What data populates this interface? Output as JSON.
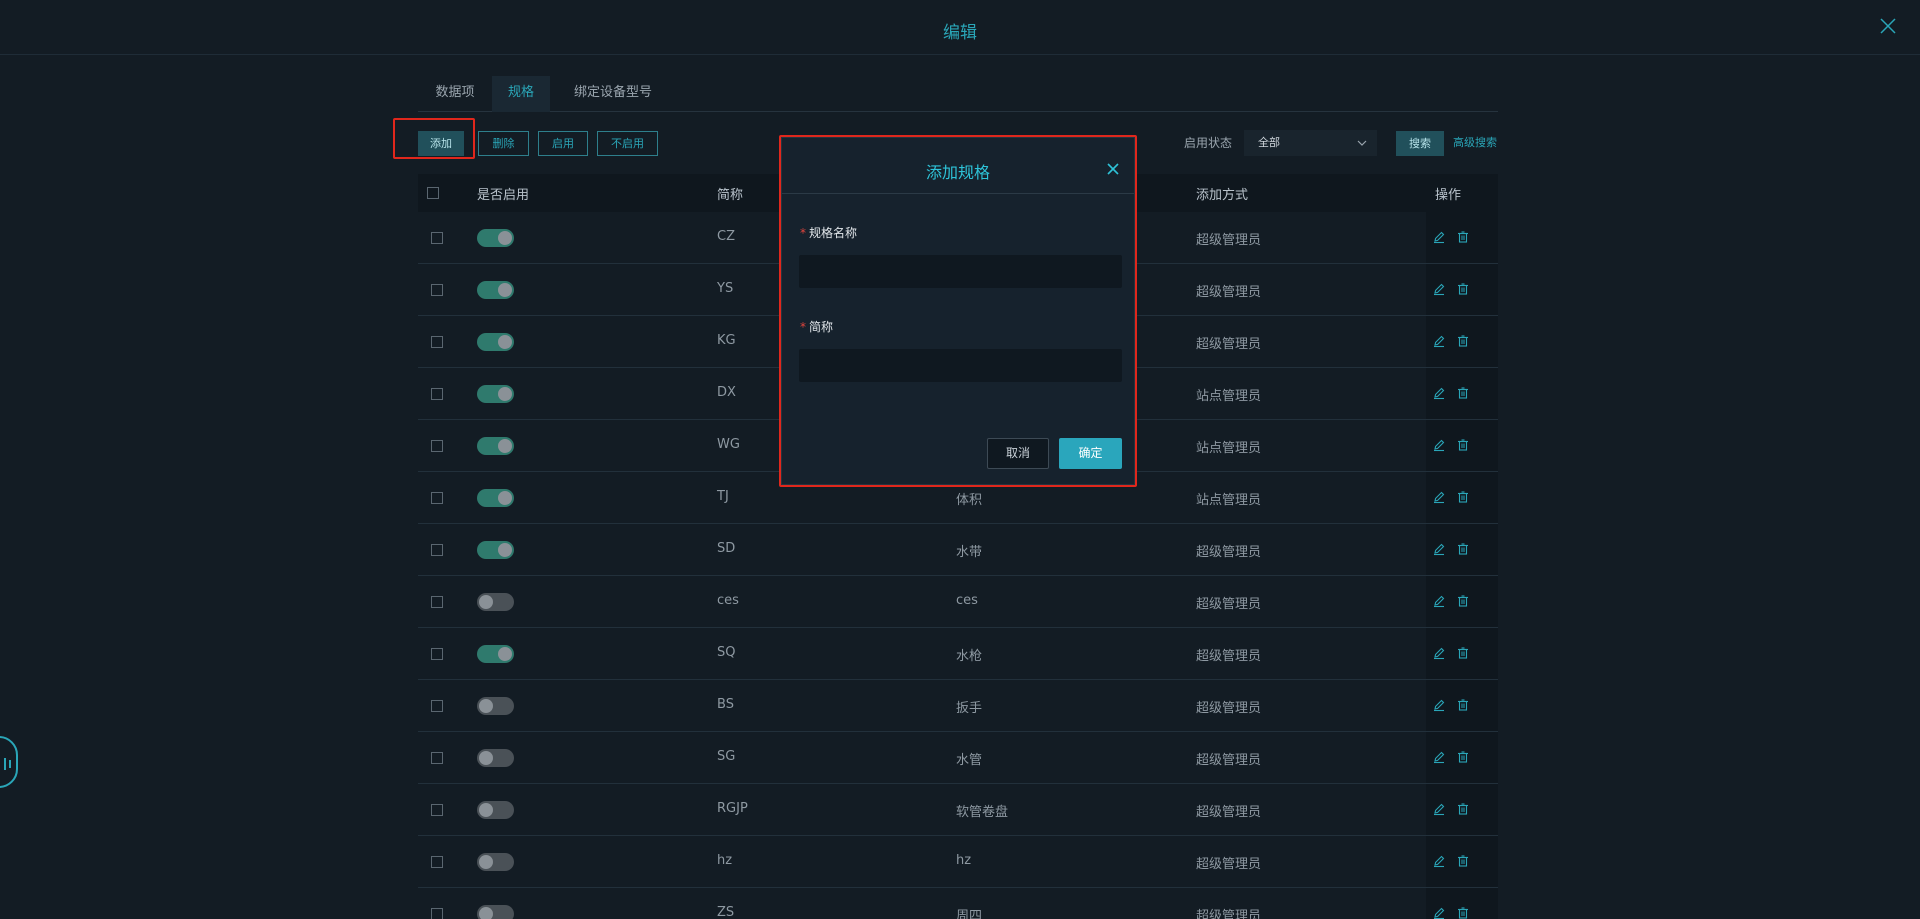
{
  "header": {
    "title": "编辑"
  },
  "tabs": [
    {
      "label": "数据项",
      "active": false
    },
    {
      "label": "规格",
      "active": true
    },
    {
      "label": "绑定设备型号",
      "active": false
    }
  ],
  "toolbar": {
    "add": "添加",
    "delete": "删除",
    "enable": "启用",
    "disable": "不启用",
    "filter_label": "启用状态",
    "filter_value": "全部",
    "search": "搜索",
    "advanced_search": "高级搜索"
  },
  "table": {
    "headers": {
      "enabled": "是否启用",
      "abbr": "简称",
      "add_method": "添加方式",
      "ops": "操作"
    },
    "rows": [
      {
        "enabled": true,
        "abbr": "CZ",
        "name": "",
        "method": "超级管理员"
      },
      {
        "enabled": true,
        "abbr": "YS",
        "name": "",
        "method": "超级管理员"
      },
      {
        "enabled": true,
        "abbr": "KG",
        "name": "",
        "method": "超级管理员"
      },
      {
        "enabled": true,
        "abbr": "DX",
        "name": "",
        "method": "站点管理员"
      },
      {
        "enabled": true,
        "abbr": "WG",
        "name": "",
        "method": "站点管理员"
      },
      {
        "enabled": true,
        "abbr": "TJ",
        "name": "体积",
        "method": "站点管理员"
      },
      {
        "enabled": true,
        "abbr": "SD",
        "name": "水带",
        "method": "超级管理员"
      },
      {
        "enabled": false,
        "abbr": "ces",
        "name": "ces",
        "method": "超级管理员"
      },
      {
        "enabled": true,
        "abbr": "SQ",
        "name": "水枪",
        "method": "超级管理员"
      },
      {
        "enabled": false,
        "abbr": "BS",
        "name": "扳手",
        "method": "超级管理员"
      },
      {
        "enabled": false,
        "abbr": "SG",
        "name": "水管",
        "method": "超级管理员"
      },
      {
        "enabled": false,
        "abbr": "RGJP",
        "name": "软管卷盘",
        "method": "超级管理员"
      },
      {
        "enabled": false,
        "abbr": "hz",
        "name": "hz",
        "method": "超级管理员"
      },
      {
        "enabled": false,
        "abbr": "ZS",
        "name": "周四",
        "method": "超级管理员"
      }
    ]
  },
  "modal": {
    "title": "添加规格",
    "field1_label": "规格名称",
    "field1_value": "",
    "field2_label": "简称",
    "field2_value": "",
    "cancel": "取消",
    "confirm": "确定"
  },
  "colors": {
    "accent": "#2aa6b8",
    "highlight_box": "#e0271c",
    "switch_on": "#2f7a6d",
    "switch_off": "#4a5157"
  }
}
